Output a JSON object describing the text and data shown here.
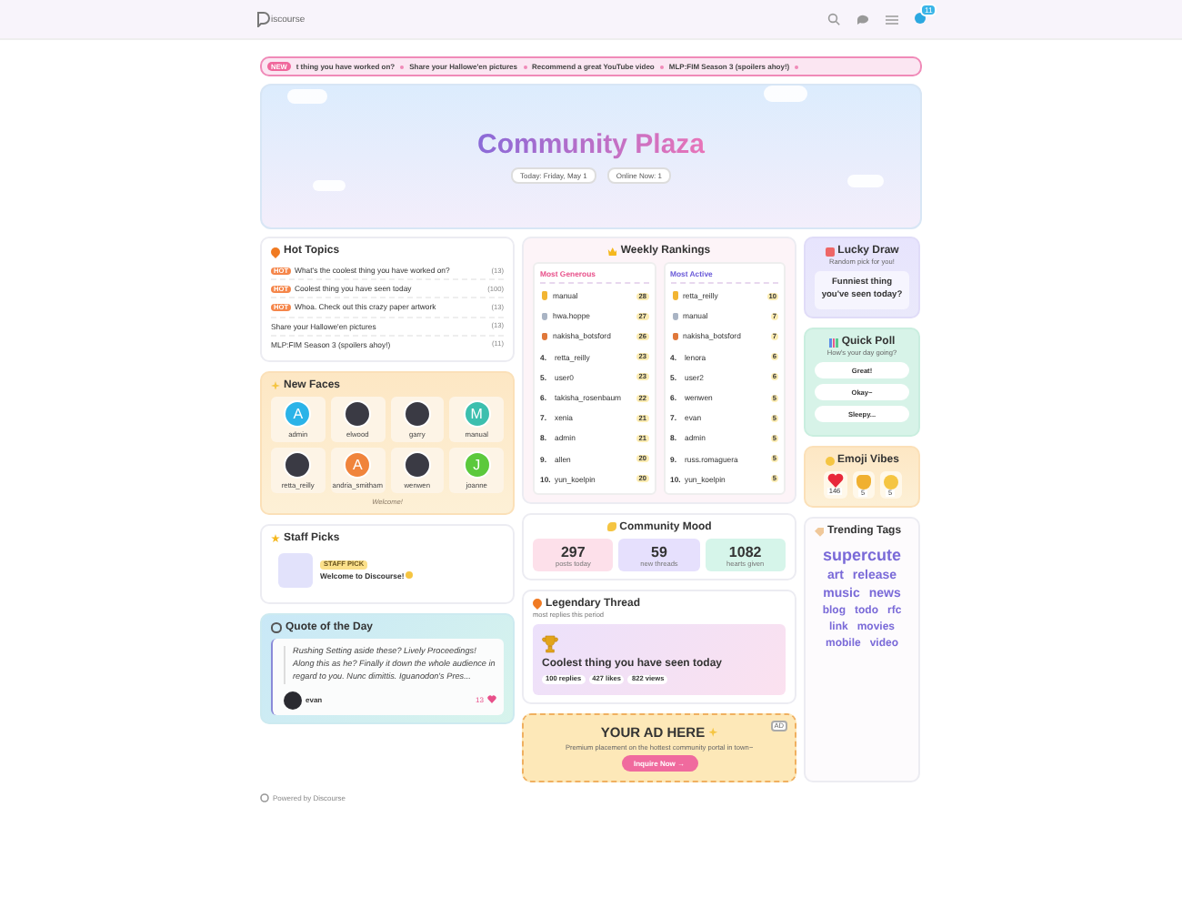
{
  "header": {
    "logo_text": "iscourse",
    "notifications": "11"
  },
  "ticker": {
    "badge": "NEW",
    "items": [
      "t thing you have worked on?",
      "Share your Hallowe'en pictures",
      "Recommend a great YouTube video",
      "MLP:FIM Season 3 (spoilers ahoy!)"
    ]
  },
  "hero": {
    "title": "Community Plaza",
    "date": "Today: Friday, May 1",
    "online": "Online Now: 1"
  },
  "hot_topics": {
    "title": "Hot Topics",
    "items": [
      {
        "title": "What's the coolest thing you have worked on?",
        "count": "(13)",
        "hot": true,
        "badge": "HOT"
      },
      {
        "title": "Coolest thing you have seen today",
        "count": "(100)",
        "hot": true,
        "badge": "HOT"
      },
      {
        "title": "Whoa. Check out this crazy paper artwork",
        "count": "(13)",
        "hot": true,
        "badge": "HOT"
      },
      {
        "title": "Share your Hallowe'en pictures",
        "count": "(13)",
        "hot": false
      },
      {
        "title": "MLP:FIM Season 3 (spoilers ahoy!)",
        "count": "(11)",
        "hot": false
      }
    ]
  },
  "new_faces": {
    "title": "New Faces",
    "footer": "Welcome!",
    "users": [
      {
        "name": "admin",
        "kind": "letter",
        "letter": "A",
        "color": "#2bb3e8"
      },
      {
        "name": "elwood",
        "kind": "photo"
      },
      {
        "name": "garry",
        "kind": "photo"
      },
      {
        "name": "manual",
        "kind": "letter",
        "letter": "M",
        "color": "#3cbfae"
      },
      {
        "name": "retta_reilly",
        "kind": "photo"
      },
      {
        "name": "andria_smitham",
        "kind": "letter",
        "letter": "A",
        "color": "#f0843c"
      },
      {
        "name": "wenwen",
        "kind": "photo"
      },
      {
        "name": "joanne",
        "kind": "letter",
        "letter": "J",
        "color": "#5cc93c"
      }
    ]
  },
  "staff_picks": {
    "title": "Staff Picks",
    "badge": "STAFF PICK",
    "topic": "Welcome to Discourse!"
  },
  "quote": {
    "title": "Quote of the Day",
    "text": "Rushing Setting aside these? Lively Proceedings! Along this as he? Finally it down the whole audience in regard to you. Nunc dimittis. Iguanodon's Pres...",
    "author": "evan",
    "likes": "13"
  },
  "rankings": {
    "title": "Weekly Rankings",
    "lists": [
      {
        "title": "Most Generous",
        "kind": "generous",
        "rows": [
          {
            "kind": "medal",
            "color": "#f2b533",
            "name": "manual",
            "count": "28"
          },
          {
            "kind": "medal",
            "color": "#a9b4c4",
            "name": "hwa.hoppe",
            "count": "27"
          },
          {
            "kind": "medal",
            "color": "#e0783a",
            "name": "nakisha_botsford",
            "count": "26"
          },
          {
            "rank": "4.",
            "name": "retta_reilly",
            "count": "23"
          },
          {
            "rank": "5.",
            "name": "user0",
            "count": "23"
          },
          {
            "rank": "6.",
            "name": "takisha_rosenbaum",
            "count": "22"
          },
          {
            "rank": "7.",
            "name": "xenia",
            "count": "21"
          },
          {
            "rank": "8.",
            "name": "admin",
            "count": "21"
          },
          {
            "rank": "9.",
            "name": "allen",
            "count": "20"
          },
          {
            "rank": "10.",
            "name": "yun_koelpin",
            "count": "20"
          }
        ]
      },
      {
        "title": "Most Active",
        "kind": "active",
        "rows": [
          {
            "kind": "medal",
            "color": "#f2b533",
            "name": "retta_reilly",
            "count": "10"
          },
          {
            "kind": "medal",
            "color": "#a9b4c4",
            "name": "manual",
            "count": "7"
          },
          {
            "kind": "medal",
            "color": "#e0783a",
            "name": "nakisha_botsford",
            "count": "7"
          },
          {
            "rank": "4.",
            "name": "lenora",
            "count": "6"
          },
          {
            "rank": "5.",
            "name": "user2",
            "count": "6"
          },
          {
            "rank": "6.",
            "name": "wenwen",
            "count": "5"
          },
          {
            "rank": "7.",
            "name": "evan",
            "count": "5"
          },
          {
            "rank": "8.",
            "name": "admin",
            "count": "5"
          },
          {
            "rank": "9.",
            "name": "russ.romaguera",
            "count": "5"
          },
          {
            "rank": "10.",
            "name": "yun_koelpin",
            "count": "5"
          }
        ]
      }
    ]
  },
  "mood": {
    "title": "Community Mood",
    "stats": [
      {
        "value": "297",
        "label": "posts today",
        "color": "#fde0ea"
      },
      {
        "value": "59",
        "label": "new threads",
        "color": "#e6e0fd"
      },
      {
        "value": "1082",
        "label": "hearts given",
        "color": "#d6f5ea"
      }
    ]
  },
  "legendary": {
    "title": "Legendary Thread",
    "subtitle": "most replies this period",
    "topic": "Coolest thing you have seen today",
    "stats": [
      "100 replies",
      "427 likes",
      "822 views"
    ]
  },
  "ad": {
    "title": "YOUR AD HERE",
    "text": "Premium placement on the hottest community portal in town~",
    "button": "Inquire Now →",
    "badge": "AD"
  },
  "lucky": {
    "title": "Lucky Draw",
    "subtitle": "Random pick for you!",
    "topic": "Funniest thing you've seen today?"
  },
  "poll": {
    "title": "Quick Poll",
    "question": "How's your day going?",
    "options": [
      "Great!",
      "Okay~",
      "Sleepy..."
    ]
  },
  "emoji": {
    "title": "Emoji Vibes",
    "items": [
      {
        "kind": "heart",
        "count": "146"
      },
      {
        "kind": "cat",
        "count": "5"
      },
      {
        "kind": "wink",
        "count": "5"
      }
    ]
  },
  "tags": {
    "title": "Trending Tags",
    "items": [
      {
        "name": "supercute",
        "kind": "big"
      },
      {
        "name": "art",
        "kind": "mid"
      },
      {
        "name": "release",
        "kind": "mid"
      },
      {
        "name": "music",
        "kind": "mid"
      },
      {
        "name": "news",
        "kind": "mid"
      },
      {
        "name": "blog",
        "kind": "small"
      },
      {
        "name": "todo",
        "kind": "small"
      },
      {
        "name": "rfc",
        "kind": "small"
      },
      {
        "name": "link",
        "kind": "small"
      },
      {
        "name": "movies",
        "kind": "small"
      },
      {
        "name": "mobile",
        "kind": "small"
      },
      {
        "name": "video",
        "kind": "small"
      }
    ]
  },
  "footer": "Powered by Discourse"
}
